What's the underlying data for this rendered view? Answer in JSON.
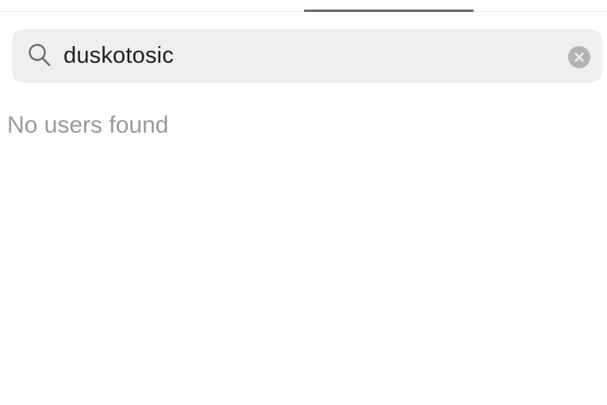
{
  "search": {
    "value": "duskotosic",
    "icon": "search-icon",
    "clear_icon": "clear-icon"
  },
  "results": {
    "empty_message": "No users found"
  },
  "colors": {
    "search_background": "#efefef",
    "tab_indicator": "#6a6a6a",
    "empty_text": "#9a9a9a",
    "clear_button": "#b3b3b3"
  }
}
